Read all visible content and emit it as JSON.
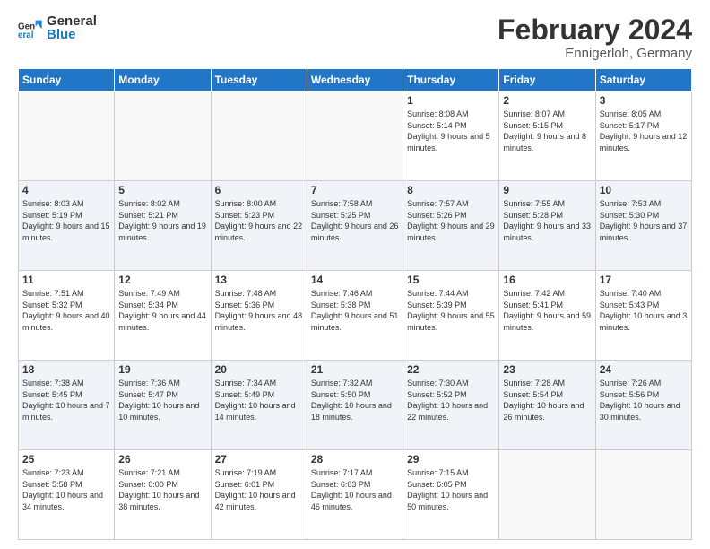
{
  "logo": {
    "general": "General",
    "blue": "Blue"
  },
  "header": {
    "title": "February 2024",
    "subtitle": "Ennigerloh, Germany"
  },
  "weekdays": [
    "Sunday",
    "Monday",
    "Tuesday",
    "Wednesday",
    "Thursday",
    "Friday",
    "Saturday"
  ],
  "weeks": [
    [
      {
        "day": "",
        "empty": true
      },
      {
        "day": "",
        "empty": true
      },
      {
        "day": "",
        "empty": true
      },
      {
        "day": "",
        "empty": true
      },
      {
        "day": "1",
        "sunrise": "8:08 AM",
        "sunset": "5:14 PM",
        "daylight": "9 hours and 5 minutes."
      },
      {
        "day": "2",
        "sunrise": "8:07 AM",
        "sunset": "5:15 PM",
        "daylight": "9 hours and 8 minutes."
      },
      {
        "day": "3",
        "sunrise": "8:05 AM",
        "sunset": "5:17 PM",
        "daylight": "9 hours and 12 minutes."
      }
    ],
    [
      {
        "day": "4",
        "sunrise": "8:03 AM",
        "sunset": "5:19 PM",
        "daylight": "9 hours and 15 minutes."
      },
      {
        "day": "5",
        "sunrise": "8:02 AM",
        "sunset": "5:21 PM",
        "daylight": "9 hours and 19 minutes."
      },
      {
        "day": "6",
        "sunrise": "8:00 AM",
        "sunset": "5:23 PM",
        "daylight": "9 hours and 22 minutes."
      },
      {
        "day": "7",
        "sunrise": "7:58 AM",
        "sunset": "5:25 PM",
        "daylight": "9 hours and 26 minutes."
      },
      {
        "day": "8",
        "sunrise": "7:57 AM",
        "sunset": "5:26 PM",
        "daylight": "9 hours and 29 minutes."
      },
      {
        "day": "9",
        "sunrise": "7:55 AM",
        "sunset": "5:28 PM",
        "daylight": "9 hours and 33 minutes."
      },
      {
        "day": "10",
        "sunrise": "7:53 AM",
        "sunset": "5:30 PM",
        "daylight": "9 hours and 37 minutes."
      }
    ],
    [
      {
        "day": "11",
        "sunrise": "7:51 AM",
        "sunset": "5:32 PM",
        "daylight": "9 hours and 40 minutes."
      },
      {
        "day": "12",
        "sunrise": "7:49 AM",
        "sunset": "5:34 PM",
        "daylight": "9 hours and 44 minutes."
      },
      {
        "day": "13",
        "sunrise": "7:48 AM",
        "sunset": "5:36 PM",
        "daylight": "9 hours and 48 minutes."
      },
      {
        "day": "14",
        "sunrise": "7:46 AM",
        "sunset": "5:38 PM",
        "daylight": "9 hours and 51 minutes."
      },
      {
        "day": "15",
        "sunrise": "7:44 AM",
        "sunset": "5:39 PM",
        "daylight": "9 hours and 55 minutes."
      },
      {
        "day": "16",
        "sunrise": "7:42 AM",
        "sunset": "5:41 PM",
        "daylight": "9 hours and 59 minutes."
      },
      {
        "day": "17",
        "sunrise": "7:40 AM",
        "sunset": "5:43 PM",
        "daylight": "10 hours and 3 minutes."
      }
    ],
    [
      {
        "day": "18",
        "sunrise": "7:38 AM",
        "sunset": "5:45 PM",
        "daylight": "10 hours and 7 minutes."
      },
      {
        "day": "19",
        "sunrise": "7:36 AM",
        "sunset": "5:47 PM",
        "daylight": "10 hours and 10 minutes."
      },
      {
        "day": "20",
        "sunrise": "7:34 AM",
        "sunset": "5:49 PM",
        "daylight": "10 hours and 14 minutes."
      },
      {
        "day": "21",
        "sunrise": "7:32 AM",
        "sunset": "5:50 PM",
        "daylight": "10 hours and 18 minutes."
      },
      {
        "day": "22",
        "sunrise": "7:30 AM",
        "sunset": "5:52 PM",
        "daylight": "10 hours and 22 minutes."
      },
      {
        "day": "23",
        "sunrise": "7:28 AM",
        "sunset": "5:54 PM",
        "daylight": "10 hours and 26 minutes."
      },
      {
        "day": "24",
        "sunrise": "7:26 AM",
        "sunset": "5:56 PM",
        "daylight": "10 hours and 30 minutes."
      }
    ],
    [
      {
        "day": "25",
        "sunrise": "7:23 AM",
        "sunset": "5:58 PM",
        "daylight": "10 hours and 34 minutes."
      },
      {
        "day": "26",
        "sunrise": "7:21 AM",
        "sunset": "6:00 PM",
        "daylight": "10 hours and 38 minutes."
      },
      {
        "day": "27",
        "sunrise": "7:19 AM",
        "sunset": "6:01 PM",
        "daylight": "10 hours and 42 minutes."
      },
      {
        "day": "28",
        "sunrise": "7:17 AM",
        "sunset": "6:03 PM",
        "daylight": "10 hours and 46 minutes."
      },
      {
        "day": "29",
        "sunrise": "7:15 AM",
        "sunset": "6:05 PM",
        "daylight": "10 hours and 50 minutes."
      },
      {
        "day": "",
        "empty": true
      },
      {
        "day": "",
        "empty": true
      }
    ]
  ]
}
